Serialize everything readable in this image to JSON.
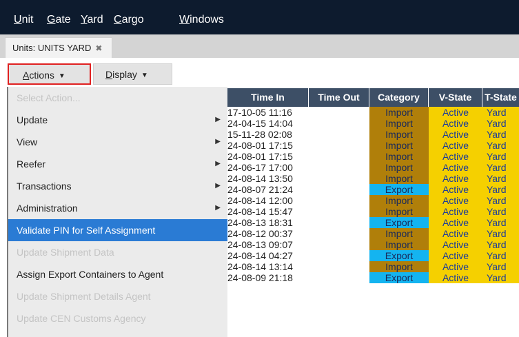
{
  "menubar": {
    "items": [
      {
        "pre": "",
        "mn": "U",
        "post": "nit"
      },
      {
        "pre": "",
        "mn": "G",
        "post": "ate"
      },
      {
        "pre": "",
        "mn": "Y",
        "post": "ard"
      },
      {
        "pre": "",
        "mn": "C",
        "post": "argo"
      },
      {
        "pre": "",
        "mn": "W",
        "post": "indows"
      }
    ]
  },
  "tab": {
    "label": "Units: UNITS YARD",
    "close": "✖"
  },
  "toolbar": {
    "actions": {
      "mn": "A",
      "rest": "ctions"
    },
    "display": {
      "mn": "D",
      "rest": "isplay"
    },
    "caret": "▼"
  },
  "grid": {
    "headers": [
      "Time In",
      "Time Out",
      "Category",
      "V-State",
      "T-State"
    ],
    "rows": [
      {
        "time_in": "17-10-05 11:16",
        "category": "Import",
        "v_state": "Active",
        "t_state": "Yard"
      },
      {
        "time_in": "24-04-15 14:04",
        "category": "Import",
        "v_state": "Active",
        "t_state": "Yard"
      },
      {
        "time_in": "15-11-28 02:08",
        "category": "Import",
        "v_state": "Active",
        "t_state": "Yard"
      },
      {
        "time_in": "24-08-01 17:15",
        "category": "Import",
        "v_state": "Active",
        "t_state": "Yard"
      },
      {
        "time_in": "24-08-01 17:15",
        "category": "Import",
        "v_state": "Active",
        "t_state": "Yard"
      },
      {
        "time_in": "24-06-17 17:00",
        "category": "Import",
        "v_state": "Active",
        "t_state": "Yard"
      },
      {
        "time_in": "24-08-14 13:50",
        "category": "Import",
        "v_state": "Active",
        "t_state": "Yard"
      },
      {
        "time_in": "24-08-07 21:24",
        "category": "Export",
        "v_state": "Active",
        "t_state": "Yard"
      },
      {
        "time_in": "24-08-14 12:00",
        "category": "Import",
        "v_state": "Active",
        "t_state": "Yard"
      },
      {
        "time_in": "24-08-14 15:47",
        "category": "Import",
        "v_state": "Active",
        "t_state": "Yard"
      },
      {
        "time_in": "24-08-13 18:31",
        "category": "Export",
        "v_state": "Active",
        "t_state": "Yard"
      },
      {
        "time_in": "24-08-12 00:37",
        "category": "Import",
        "v_state": "Active",
        "t_state": "Yard"
      },
      {
        "time_in": "24-08-13 09:07",
        "category": "Import",
        "v_state": "Active",
        "t_state": "Yard"
      },
      {
        "time_in": "24-08-14 04:27",
        "category": "Export",
        "v_state": "Active",
        "t_state": "Yard"
      },
      {
        "time_in": "24-08-14 13:14",
        "category": "Import",
        "v_state": "Active",
        "t_state": "Yard"
      },
      {
        "time_in": "24-08-09 21:18",
        "category": "Export",
        "v_state": "Active",
        "t_state": "Yard"
      }
    ],
    "colors": {
      "import": "#b07f0a",
      "export": "#14b4f0",
      "state": "#f5d000",
      "header": "#3d4f66"
    }
  },
  "action_menu": {
    "items": [
      {
        "label": "Select Action...",
        "state": "disabled",
        "submenu": false
      },
      {
        "label": "Update",
        "state": "normal",
        "submenu": true
      },
      {
        "label": "View",
        "state": "normal",
        "submenu": true
      },
      {
        "label": "Reefer",
        "state": "normal",
        "submenu": true
      },
      {
        "label": "Transactions",
        "state": "normal",
        "submenu": true
      },
      {
        "label": "Administration",
        "state": "normal",
        "submenu": true
      },
      {
        "label": "Validate PIN for Self Assignment",
        "state": "selected",
        "submenu": false
      },
      {
        "label": "Update Shipment Data",
        "state": "disabled",
        "submenu": false
      },
      {
        "label": "Assign Export Containers to Agent",
        "state": "normal",
        "submenu": false
      },
      {
        "label": "Update Shipment Details Agent",
        "state": "disabled",
        "submenu": false
      },
      {
        "label": "Update CEN Customs Agency",
        "state": "disabled",
        "submenu": false
      }
    ],
    "submenu_icon": "▶"
  }
}
